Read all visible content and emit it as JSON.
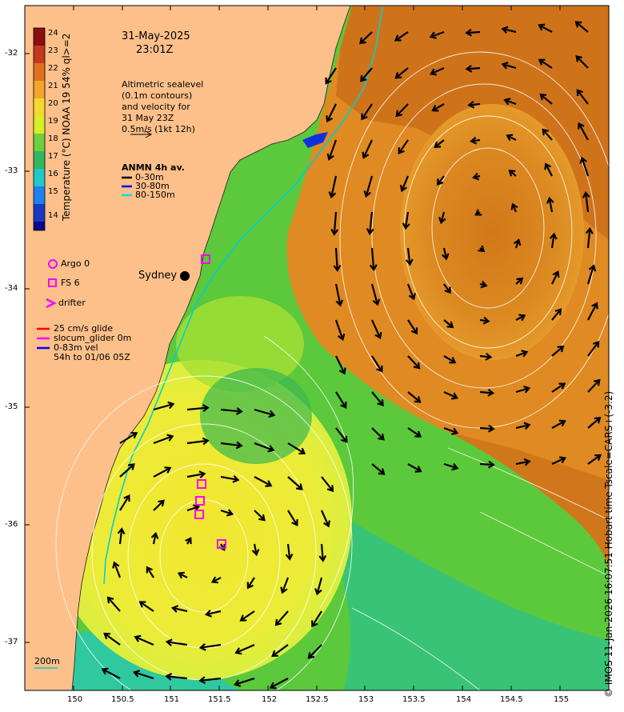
{
  "date": {
    "day": "31-May-2025",
    "time": "23:01Z"
  },
  "altimetry_note": [
    "Altimetric sealevel",
    "(0.1m contours)",
    "and velocity for",
    "31 May 23Z",
    "0.5m/s (1kt 12h)"
  ],
  "colorbar": {
    "label": "Temperature (°C) NOAA 19 54% ql>=2",
    "ticks": [
      "24",
      "23",
      "22",
      "21",
      "20",
      "19",
      "18",
      "17",
      "16",
      "15",
      "14"
    ],
    "colors": [
      "#8a0f0f",
      "#c23a1a",
      "#e07020",
      "#f4a52a",
      "#f7d830",
      "#e8f020",
      "#a8e040",
      "#40c040",
      "#18a880",
      "#20c8e0",
      "#2080f0",
      "#1838c0",
      "#0a0a8a"
    ]
  },
  "anmn": {
    "title": "ANMN 4h av.",
    "items": [
      "0-30m",
      "30-80m",
      "80-150m"
    ],
    "colors": [
      "#000000",
      "#0000ff",
      "#00e0e0"
    ]
  },
  "markers": {
    "argo": "Argo 0",
    "fs": "FS 6",
    "drifter": "drifter",
    "marker_color": "#ff00ff"
  },
  "glider": {
    "lines": [
      "25 cm/s glide",
      "slocum_glider 0m",
      "0-83m vel",
      "54h to 01/06 05Z"
    ],
    "colors": [
      "#ff0000",
      "#ff00ff",
      "#0000ff"
    ]
  },
  "place": {
    "sydney": "Sydney"
  },
  "scale_label": "200m",
  "x_ticks": [
    "150",
    "150.5",
    "151",
    "151.5",
    "152",
    "152.5",
    "153",
    "153.5",
    "154",
    "154.5",
    "155"
  ],
  "y_ticks": [
    "-32",
    "-33",
    "-34",
    "-35",
    "-36",
    "-37"
  ],
  "credit": "© IMOS 11-Jan-2026 16:07:51 Hobart time Tscale=CARS+(-3.2)",
  "colors": {
    "land": "#fdc08a",
    "warm_water": "#e28a1e",
    "cool_water": "#56c83a",
    "eddy_core": "#e6e630",
    "contour": "#ffffff",
    "isobath": "#00d0d0"
  }
}
